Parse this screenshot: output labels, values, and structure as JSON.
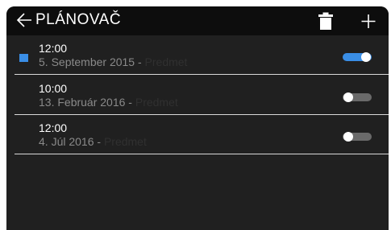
{
  "header": {
    "title": "PLÁNOVAČ",
    "back_icon": "back-arrow-icon",
    "delete_icon": "trash-icon",
    "add_icon": "plus-icon"
  },
  "alarms": [
    {
      "time": "12:00",
      "date": "5. September 2015 - ",
      "subject": "Predmet",
      "enabled": true,
      "selected": true
    },
    {
      "time": "10:00",
      "date": "13. Február 2016 - ",
      "subject": "Predmet",
      "enabled": false,
      "selected": false
    },
    {
      "time": "12:00",
      "date": "4. Júl 2016 - ",
      "subject": "Predmet",
      "enabled": false,
      "selected": false
    }
  ],
  "colors": {
    "accent": "#3a8ee6",
    "background": "#202020",
    "header": "#0d0d0d",
    "divider": "#d9d9d9"
  }
}
